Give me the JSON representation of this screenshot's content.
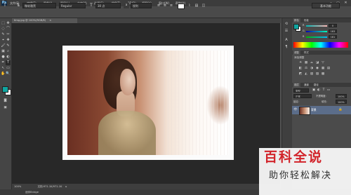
{
  "app": {
    "logo": "Ps"
  },
  "menubar": {
    "items": [
      "文件(F)",
      "编辑(E)",
      "图像(I)",
      "图层(L)",
      "文字(Y)",
      "选择(S)",
      "滤镜(T)",
      "3D(D)",
      "视图(V)",
      "窗口(W)",
      "帮助(H)"
    ],
    "window_controls": [
      "–",
      "▭",
      "✕"
    ]
  },
  "options": {
    "tool_icon": "T",
    "orient_icon": "⇅",
    "font_family": "微软雅黑",
    "font_style": "Regular",
    "size_icon": "T",
    "font_size": "30 点",
    "aa_label": "a",
    "aa_value": "锐利",
    "workspace": "基本功能"
  },
  "document": {
    "tab_label": "timg.jpg @ 100%(RGB/8)",
    "close": "×"
  },
  "status": {
    "zoom": "100%",
    "doc_info": "文档:971.1K/971.1K",
    "bottom_left": "迷你Bridge"
  },
  "tools": [
    "⬚",
    "✥",
    "◌",
    "⌒",
    "✎",
    "✂",
    "⌖",
    "✚",
    "🖌",
    "✎",
    "▣",
    "⌕",
    "●",
    "◐",
    "✒",
    "T",
    "↖",
    "▭",
    "✋",
    "🔍"
  ],
  "colors": {
    "foreground": "#10a5a0",
    "background": "#ffffff",
    "accent": "#2f82c6"
  },
  "color_panel": {
    "tabs": [
      "颜色",
      "色板"
    ],
    "r": "0",
    "g": "183",
    "b": "181",
    "labels": [
      "R",
      "G",
      "B"
    ]
  },
  "adjustments": {
    "tabs": [
      "调整",
      "样式"
    ],
    "title": "添加调整",
    "row1": [
      "☀",
      "▦",
      "⌓",
      "◪",
      "▽"
    ],
    "row2": [
      "◧",
      "⚖",
      "◑",
      "◉",
      "▦",
      "▤"
    ],
    "row3": [
      "◩",
      "◭",
      "▧",
      "▨",
      "▩"
    ]
  },
  "layers": {
    "tabs": [
      "图层",
      "通道",
      "路径"
    ],
    "filter_kind": "类型",
    "blend_mode": "正常",
    "opacity_label": "不透明度:",
    "opacity": "100%",
    "lock_label": "锁定:",
    "fill_label": "填充:",
    "fill": "100%",
    "layer_name": "背景"
  },
  "watermark": {
    "title": "百科全说",
    "subtitle": "助你轻松解决"
  }
}
